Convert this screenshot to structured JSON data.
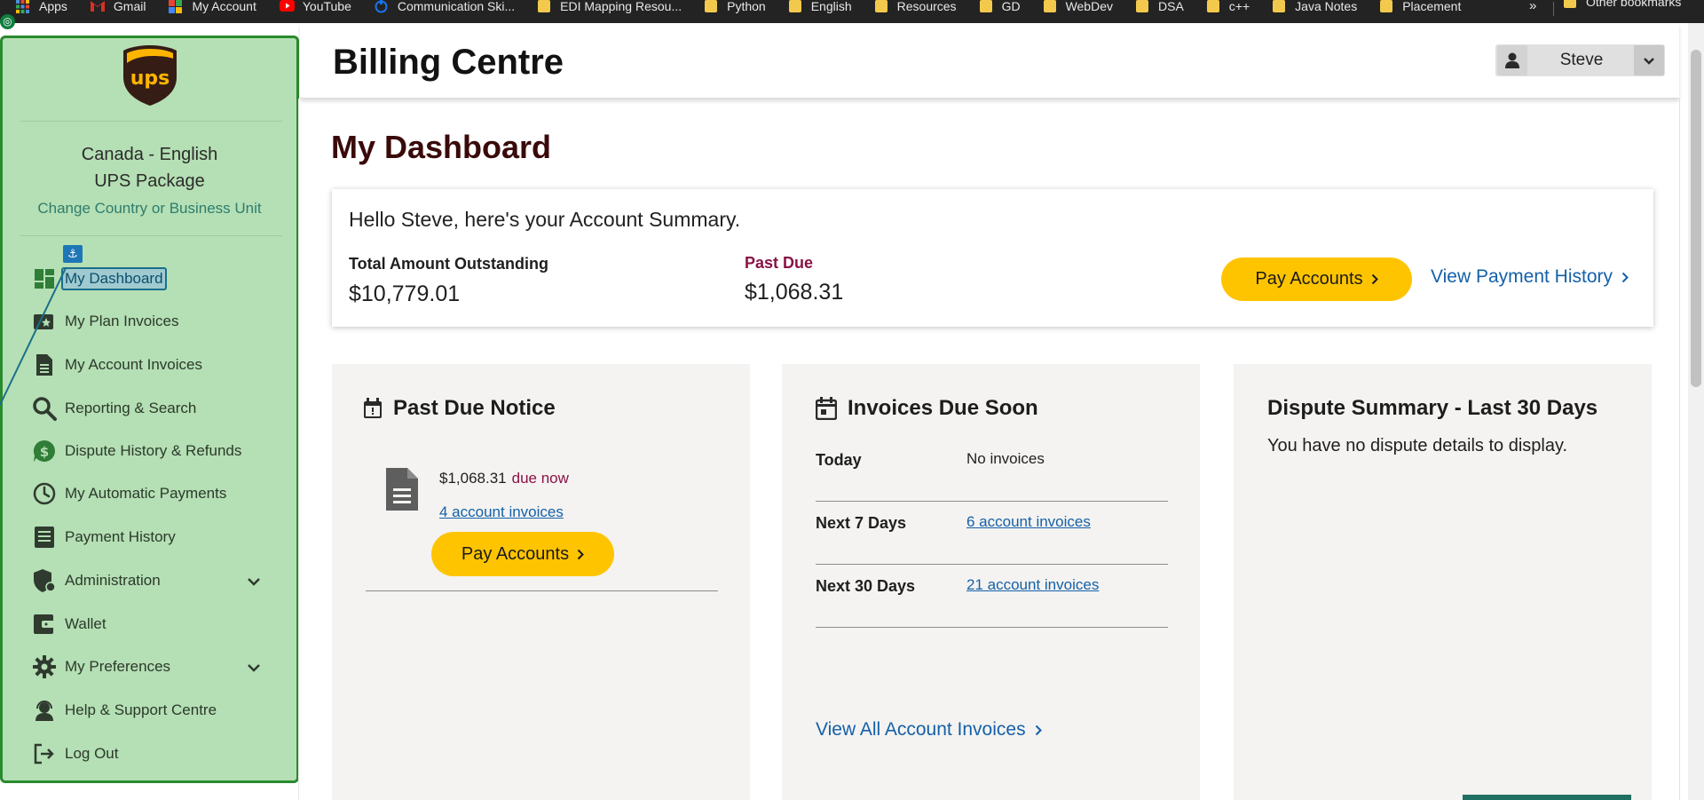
{
  "bookmarks": {
    "items": [
      {
        "label": "Apps",
        "icon": "apps-grid-icon",
        "color": "#4a90d9"
      },
      {
        "label": "Gmail",
        "icon": "gmail-icon",
        "color": "#d93025"
      },
      {
        "label": "My Account",
        "icon": "google-icon",
        "color": "#34a853"
      },
      {
        "label": "YouTube",
        "icon": "youtube-icon",
        "color": "#ff0000"
      },
      {
        "label": "Communication Ski...",
        "icon": "edu-icon",
        "color": "#1a73e8"
      },
      {
        "label": "EDI Mapping Resou...",
        "icon": "folder-icon"
      },
      {
        "label": "Python",
        "icon": "folder-icon"
      },
      {
        "label": "English",
        "icon": "folder-icon"
      },
      {
        "label": "Resources",
        "icon": "folder-icon"
      },
      {
        "label": "GD",
        "icon": "folder-icon"
      },
      {
        "label": "WebDev",
        "icon": "folder-icon"
      },
      {
        "label": "DSA",
        "icon": "folder-icon"
      },
      {
        "label": "c++",
        "icon": "folder-icon"
      },
      {
        "label": "Java Notes",
        "icon": "folder-icon"
      },
      {
        "label": "Placement",
        "icon": "folder-icon"
      }
    ],
    "overflow": "»",
    "other": "Other bookmarks"
  },
  "sidebar": {
    "logo_text": "ups",
    "locale_country": "Canada - English",
    "locale_unit": "UPS Package",
    "change_country": "Change Country or Business Unit",
    "anchor_badge": "⚓",
    "items": [
      {
        "label": "My Dashboard",
        "icon": "dashboard-icon",
        "active": true
      },
      {
        "label": "My Plan Invoices",
        "icon": "plan-invoices-icon"
      },
      {
        "label": "My Account Invoices",
        "icon": "document-icon"
      },
      {
        "label": "Reporting & Search",
        "icon": "search-icon"
      },
      {
        "label": "Dispute History & Refunds",
        "icon": "dollar-chat-icon"
      },
      {
        "label": "My Automatic Payments",
        "icon": "clock-icon"
      },
      {
        "label": "Payment History",
        "icon": "list-icon"
      },
      {
        "label": "Administration",
        "icon": "shield-user-icon",
        "expandable": true
      },
      {
        "label": "Wallet",
        "icon": "wallet-icon"
      },
      {
        "label": "My Preferences",
        "icon": "gear-icon",
        "expandable": true
      },
      {
        "label": "Help & Support Centre",
        "icon": "headset-icon"
      },
      {
        "label": "Log Out",
        "icon": "logout-icon"
      }
    ]
  },
  "header": {
    "title": "Billing Centre",
    "user_name": "Steve"
  },
  "dashboard": {
    "title": "My Dashboard",
    "summary": {
      "greeting": "Hello Steve, here's your Account Summary.",
      "total_label": "Total Amount Outstanding",
      "total_value": "$10,779.01",
      "past_due_label": "Past Due",
      "past_due_value": "$1,068.31",
      "pay_button": "Pay Accounts",
      "history_link": "View Payment History"
    },
    "past_due_notice": {
      "title": "Past Due Notice",
      "amount": "$1,068.31",
      "due_text": "due now",
      "invoices_link": "4 account invoices",
      "pay_button": "Pay Accounts"
    },
    "invoices_due_soon": {
      "title": "Invoices Due Soon",
      "rows": [
        {
          "label": "Today",
          "value": "No invoices",
          "link": false
        },
        {
          "label": "Next 7 Days",
          "value": "6 account invoices",
          "link": true
        },
        {
          "label": "Next 30 Days",
          "value": "21 account invoices",
          "link": true
        }
      ],
      "view_all": "View All Account Invoices"
    },
    "dispute_summary": {
      "title": "Dispute Summary - Last 30 Days",
      "text": "You have no dispute details to display."
    }
  },
  "colors": {
    "sidebar_bg": "#b5dfb4",
    "sidebar_border": "#2a8a2e",
    "pay_button": "#ffc400",
    "link": "#1560a8",
    "past_due": "#8a1245",
    "ups_brown": "#351c15",
    "ups_gold": "#ffb500"
  }
}
